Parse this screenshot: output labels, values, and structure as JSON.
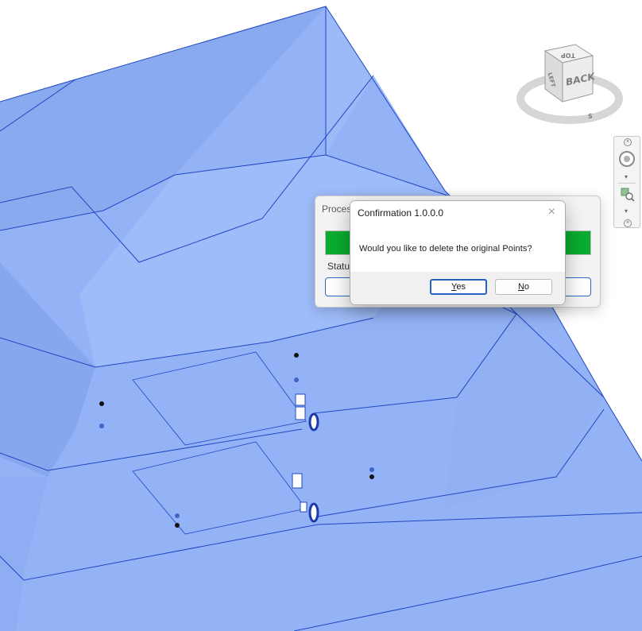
{
  "process_window": {
    "title": "Proces",
    "status_label": "Statu",
    "progress": 1.0
  },
  "confirm_dialog": {
    "title": "Confirmation 1.0.0.0",
    "close_icon": "×",
    "message": "Would you like to delete the original Points?",
    "yes": {
      "mnemonic": "Y",
      "rest": "es"
    },
    "no": {
      "mnemonic": "N",
      "rest": "o"
    }
  },
  "viewcube": {
    "face_front": "BACK",
    "face_top": "TOP",
    "face_left": "LEFT",
    "compass_s": "S"
  },
  "navbar": {
    "close_icon": "×",
    "down_icon": "▾"
  },
  "colors": {
    "model_fill": "#94b3f7",
    "model_edge": "#1f47c2",
    "progress_green": "#0aab2f",
    "accent_blue": "#2563c9"
  },
  "icons": [
    "close-icon",
    "steering-wheel-icon",
    "zoom-icon",
    "chevron-down-icon"
  ]
}
